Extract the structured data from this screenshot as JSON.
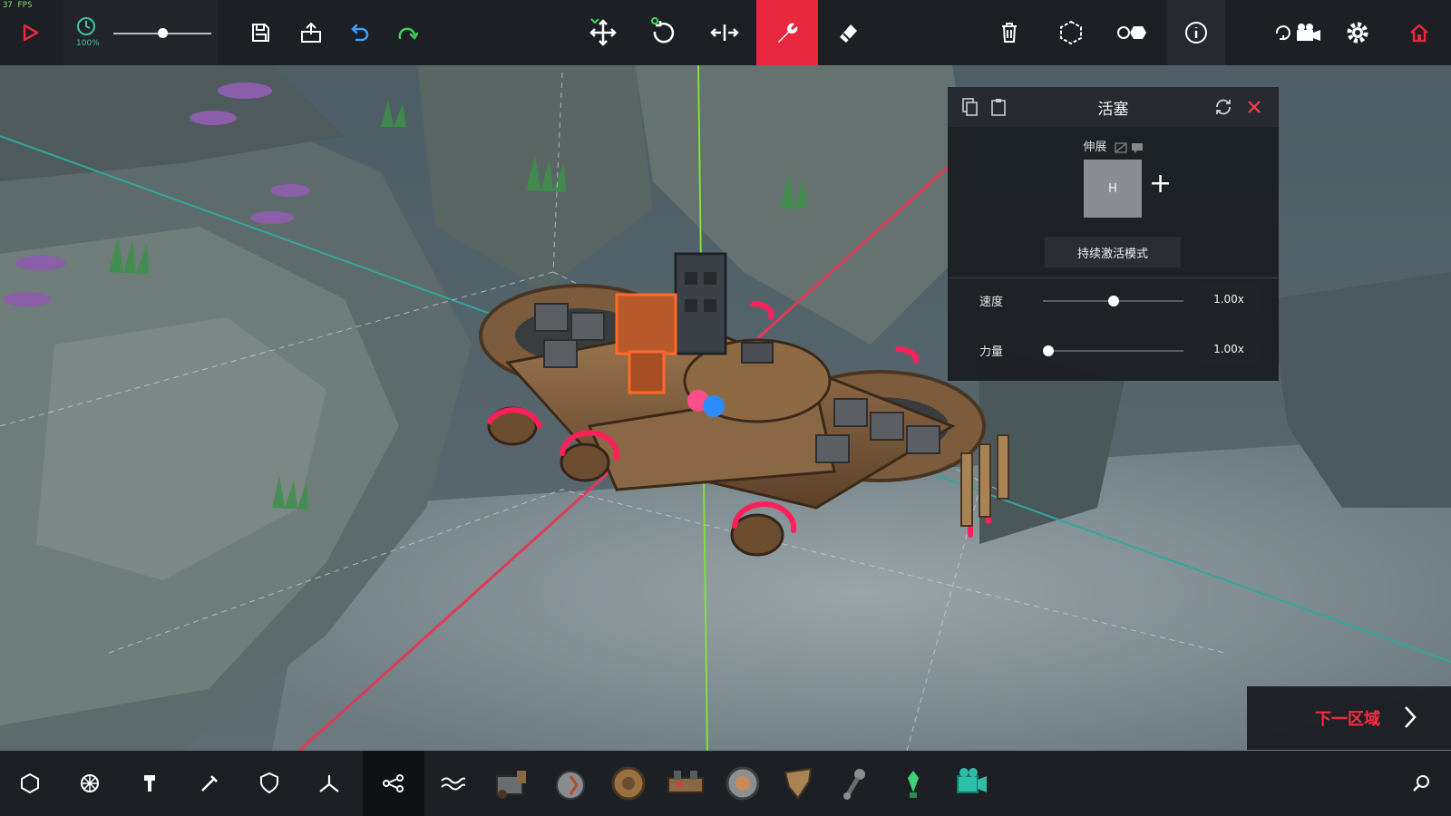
{
  "topbar": {
    "fps": "37 FPS",
    "speed_percent": "100%",
    "time_scale": 0.5,
    "icons": {
      "play": "play-icon",
      "clock": "clock-icon",
      "save": "save-icon",
      "load": "load-icon",
      "undo": "undo-icon",
      "redo": "redo-icon",
      "translate": "move-icon",
      "rotate": "rotate-icon",
      "mirror": "mirror-icon",
      "wrench": "wrench-icon",
      "eraser": "eraser-icon",
      "delete": "trash-icon",
      "center": "hexagon-icon",
      "pivot": "pivot-icon",
      "info": "info-icon",
      "camera": "camera-icon",
      "settings": "gear-icon",
      "home": "home-icon"
    },
    "accent": "#e8283f"
  },
  "panel": {
    "title": "活塞",
    "section": "伸展",
    "key": "H",
    "add": "+",
    "mode_button": "持续激活模式",
    "speed": {
      "label": "速度",
      "value": "1.00x",
      "level": 0.5
    },
    "force": {
      "label": "力量",
      "value": "1.00x",
      "level": 0.0
    }
  },
  "next_zone": {
    "label": "下一区域"
  },
  "bottombar": {
    "categories": [
      "basic-blocks",
      "mechanical",
      "automation",
      "weapons",
      "armour",
      "flight",
      "utility",
      "water"
    ],
    "active_category": "utility",
    "blocks": [
      "piston-block",
      "steering-hinge",
      "wheel-block",
      "suspension-block",
      "spinning-block",
      "grabber-block",
      "connector-block",
      "ballast-block",
      "camera-block"
    ]
  }
}
